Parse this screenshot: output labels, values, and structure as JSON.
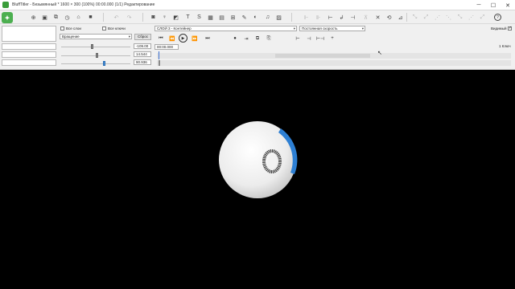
{
  "window": {
    "title": "BluffTitler - Безымянный * 1600 × 300 (100%) 00:00.000 (1/1) Редактирование",
    "minimize": "─",
    "maximize": "☐",
    "close": "✕"
  },
  "toolbar": {
    "icons": [
      "new-layer-icon",
      "open-icon",
      "save-icon",
      "settings-icon",
      "clock-icon",
      "folder-icon",
      "stop-icon",
      "undo-icon",
      "redo-icon",
      "camera-icon",
      "light-icon",
      "text-icon",
      "picture-icon",
      "music-icon",
      "help-icon"
    ],
    "text_icon_label": "T",
    "s_icon_label": "S",
    "help_label": "?"
  },
  "panel": {
    "all_layers_label": "Все слои",
    "all_keys_label": "Все ключи",
    "property_select": "Вращение",
    "reset_button": "Сброс",
    "layer_select": "СЛОЙ 3 - Контейнер",
    "speed_select": "Постоянная скорость",
    "visible_label": "Видимый",
    "visible_checked": true,
    "time_value": "00:00.000",
    "value_1": "-109.00",
    "value_2": "14.544",
    "value_3": "90.936",
    "key_count": "1 Ключ",
    "slider_levels": [
      0.45,
      0.52,
      0.62
    ]
  },
  "colors": {
    "stage_bg": "#000000",
    "sphere": "#f2f2f2",
    "accent_blue": "#2d7fd3"
  }
}
